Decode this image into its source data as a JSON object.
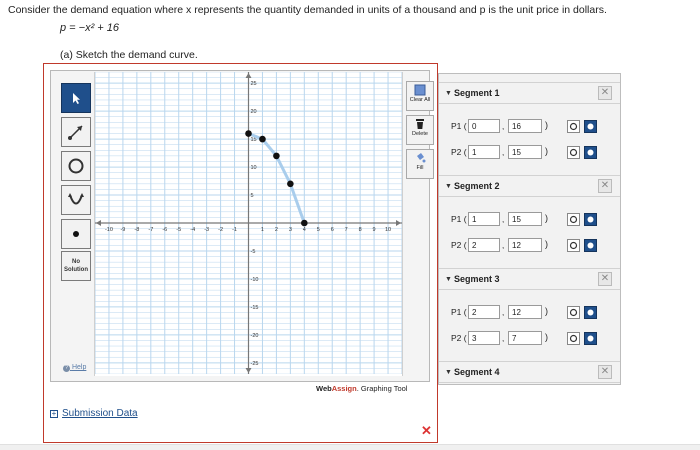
{
  "question": {
    "text": "Consider the demand equation where x represents the quantity demanded in units of a thousand and p is the unit price in dollars.",
    "equation": "p = −x² + 16",
    "part_a": "(a) Sketch the demand curve."
  },
  "toolbar": {
    "no_solution_line1": "No",
    "no_solution_line2": "Solution",
    "help": "Help",
    "clear_all": "Clear All",
    "delete": "Delete",
    "fill": "Fill"
  },
  "brand": {
    "web": "Web",
    "assign": "Assign",
    "rest": ". Graphing Tool"
  },
  "submission": {
    "box": "+",
    "label": "Submission Data"
  },
  "close_symbol": "✕",
  "segments": [
    {
      "title": "Segment 1",
      "p1_label": "P1 (",
      "p1_x": "0",
      "p1_y": "16",
      "p2_label": "P2 (",
      "p2_x": "1",
      "p2_y": "15"
    },
    {
      "title": "Segment 2",
      "p1_label": "P1 (",
      "p1_x": "1",
      "p1_y": "15",
      "p2_label": "P2 (",
      "p2_x": "2",
      "p2_y": "12"
    },
    {
      "title": "Segment 3",
      "p1_label": "P1 (",
      "p1_x": "2",
      "p1_y": "12",
      "p2_label": "P2 (",
      "p2_x": "3",
      "p2_y": "7"
    },
    {
      "title": "Segment 4"
    }
  ],
  "graph": {
    "x_range": [
      -11,
      11
    ],
    "y_range": [
      -27,
      27
    ],
    "x_tick_labels": [
      "-10",
      "-9",
      "-8",
      "-7",
      "-6",
      "-5",
      "-4",
      "-3",
      "-2",
      "-1",
      "1",
      "2",
      "3",
      "4",
      "5",
      "6",
      "7",
      "8",
      "9",
      "10"
    ],
    "x_tick_values": [
      -10,
      -9,
      -8,
      -7,
      -6,
      -5,
      -4,
      -3,
      -2,
      -1,
      1,
      2,
      3,
      4,
      5,
      6,
      7,
      8,
      9,
      10
    ],
    "y_tick_labels": [
      "25",
      "20",
      "15",
      "10",
      "5",
      "-5",
      "-10",
      "-15",
      "-20",
      "-25"
    ],
    "y_tick_values": [
      25,
      20,
      15,
      10,
      5,
      -5,
      -10,
      -15,
      -20,
      -25
    ],
    "points": [
      [
        0,
        16
      ],
      [
        1,
        15
      ],
      [
        2,
        12
      ],
      [
        3,
        7
      ],
      [
        4,
        0
      ]
    ],
    "line_color": "#a9cdec",
    "point_color": "#111111",
    "grid_color": "#b9d6ee"
  }
}
